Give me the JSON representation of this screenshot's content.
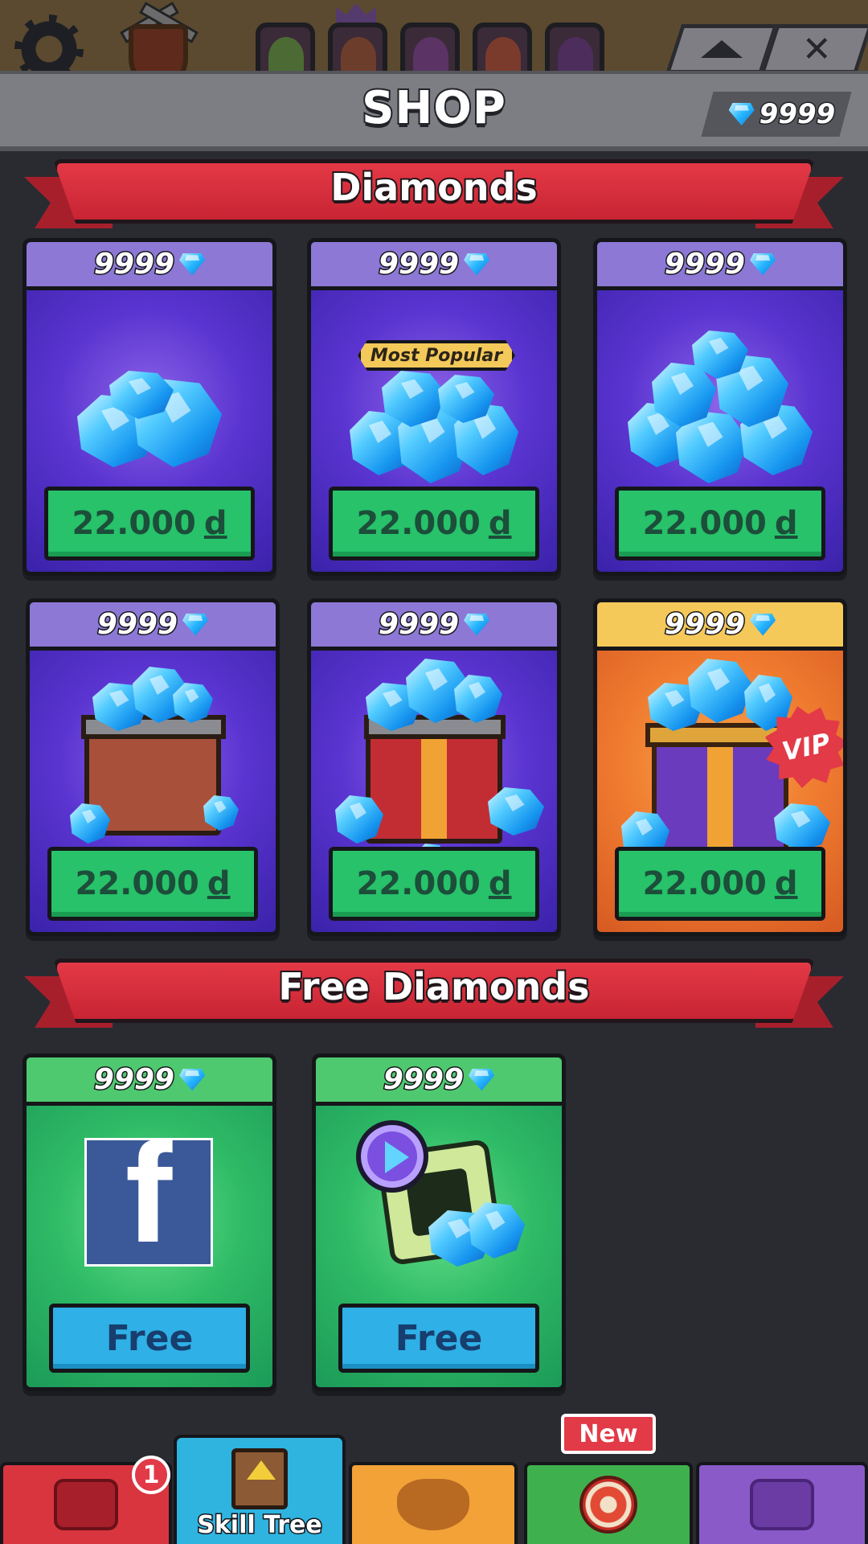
{
  "header": {
    "title": "SHOP",
    "balance": "9999",
    "icons": [
      "gear-icon",
      "shield-icon",
      "collapse-icon",
      "close-icon"
    ]
  },
  "sections": {
    "diamonds_title": "Diamonds",
    "free_title": "Free Diamonds"
  },
  "diamond_offers": [
    {
      "amount": "9999",
      "price": "22.000",
      "currency": "d",
      "art": "small-gem-pile"
    },
    {
      "amount": "9999",
      "price": "22.000",
      "currency": "d",
      "art": "medium-gem-pile",
      "tag": "Most Popular"
    },
    {
      "amount": "9999",
      "price": "22.000",
      "currency": "d",
      "art": "large-gem-pile"
    },
    {
      "amount": "9999",
      "price": "22.000",
      "currency": "d",
      "art": "wooden-chest-gems"
    },
    {
      "amount": "9999",
      "price": "22.000",
      "currency": "d",
      "art": "red-chest-gems"
    },
    {
      "amount": "9999",
      "price": "22.000",
      "currency": "d",
      "art": "vip-chest-gems",
      "tag": "VIP"
    }
  ],
  "free_offers": [
    {
      "amount": "9999",
      "button": "Free",
      "art": "facebook-icon",
      "glyph": "f"
    },
    {
      "amount": "9999",
      "button": "Free",
      "art": "video-ad-icon"
    }
  ],
  "nav": {
    "tabs": [
      {
        "name": "chest",
        "color": "#d9353f"
      },
      {
        "name": "skill-tree",
        "label": "Skill Tree",
        "color": "#2fb3df"
      },
      {
        "name": "character",
        "color": "#f2a237"
      },
      {
        "name": "target",
        "color": "#3fb04e"
      },
      {
        "name": "inventory",
        "color": "#8a5ac8"
      }
    ],
    "notification_count": "1",
    "new_badge": "New"
  },
  "colors": {
    "background": "#2a2b31",
    "ribbon_red": "#d42c3a",
    "price_green": "#27c26a",
    "free_blue": "#2fb0e6",
    "card_purple": "#5a34d0",
    "vip_orange": "#ef7a2f"
  }
}
